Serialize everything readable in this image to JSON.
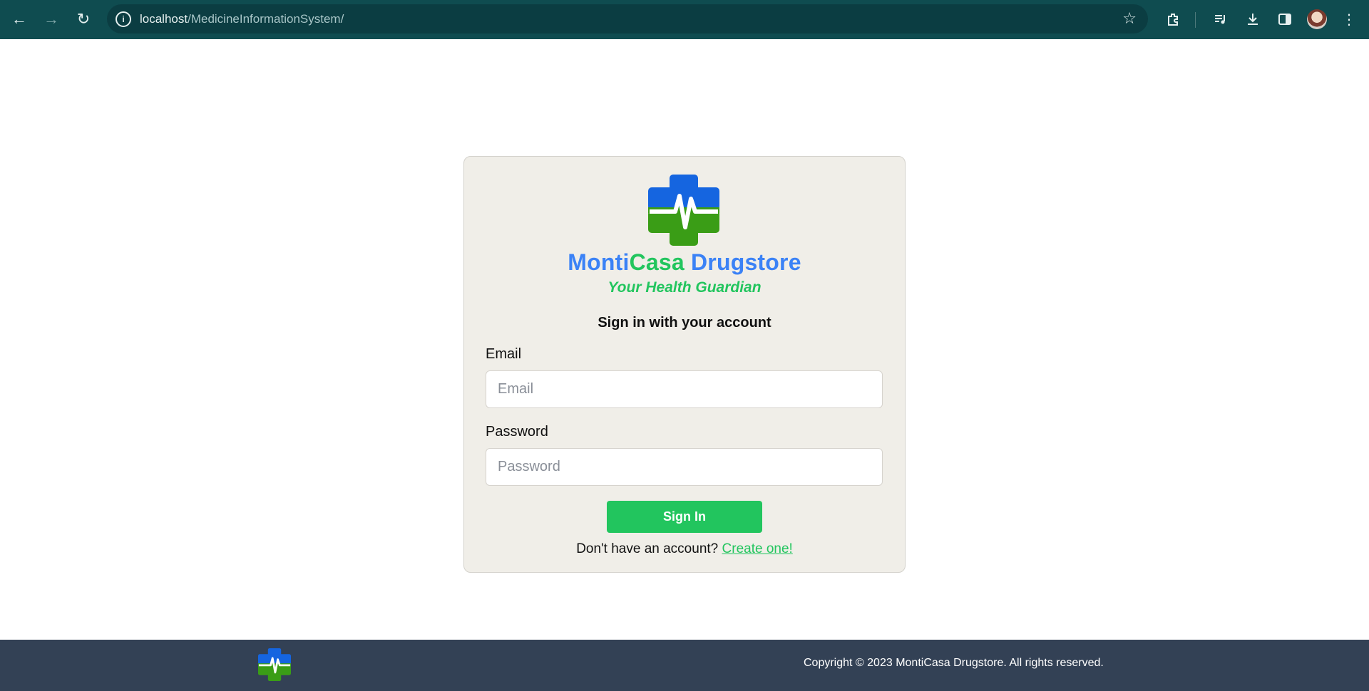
{
  "browser": {
    "url_host": "localhost",
    "url_path": "/MedicineInformationSystem/",
    "icons": [
      "back-icon",
      "forward-icon",
      "reload-icon",
      "site-info-icon",
      "star-icon",
      "extensions-icon",
      "media-icon",
      "download-icon",
      "side-panel-icon",
      "profile-avatar",
      "menu-icon"
    ]
  },
  "login": {
    "brand_part1": "Monti",
    "brand_part2": "Casa",
    "brand_part3": "Drugstore",
    "tagline": "Your Health Guardian",
    "heading": "Sign in with your account",
    "email_label": "Email",
    "email_placeholder": "Email",
    "password_label": "Password",
    "password_placeholder": "Password",
    "signin_label": "Sign In",
    "signup_prompt": "Don't have an account?",
    "signup_link": "Create one!"
  },
  "footer": {
    "copyright": "Copyright © 2023 MontiCasa Drugstore. All rights reserved."
  },
  "colors": {
    "chrome_bg": "#0f4c50",
    "brand_blue": "#3b82f6",
    "brand_green": "#22c55e",
    "card_bg": "#f0eee8",
    "footer_bg": "#334155"
  }
}
